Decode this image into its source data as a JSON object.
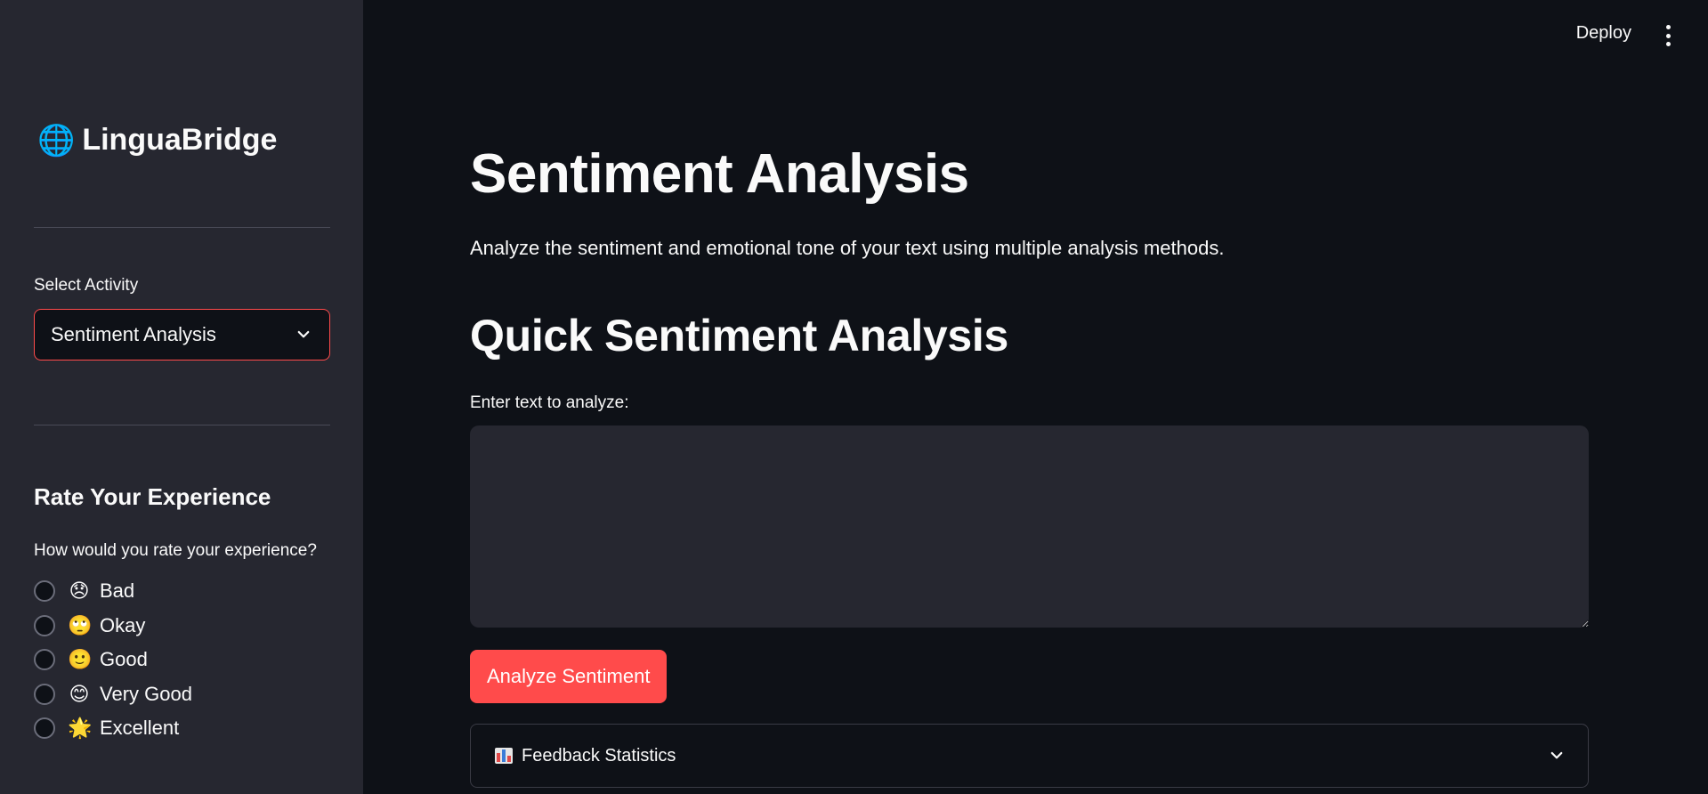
{
  "sidebar": {
    "brand": "LinguaBridge",
    "select_label": "Select Activity",
    "select_value": "Sentiment Analysis",
    "rating_title": "Rate Your Experience",
    "rating_question": "How would you rate your experience?",
    "options": [
      {
        "emoji": "😞",
        "label": "Bad"
      },
      {
        "emoji": "🙄",
        "label": "Okay"
      },
      {
        "emoji": "🙂",
        "label": "Good"
      },
      {
        "emoji": "😊",
        "label": "Very Good"
      },
      {
        "emoji": "🌟",
        "label": "Excellent"
      }
    ]
  },
  "header": {
    "deploy_label": "Deploy",
    "menu_icon": "kebab-menu-icon"
  },
  "main": {
    "title": "Sentiment Analysis",
    "description": "Analyze the sentiment and emotional tone of your text using multiple analysis methods.",
    "section_title": "Quick Sentiment Analysis",
    "input_label": "Enter text to analyze:",
    "input_value": "",
    "button_label": "Analyze Sentiment",
    "expander_label": "Feedback Statistics"
  },
  "colors": {
    "accent": "#ff4b4b",
    "background": "#0e1117",
    "sidebar": "#262730"
  }
}
